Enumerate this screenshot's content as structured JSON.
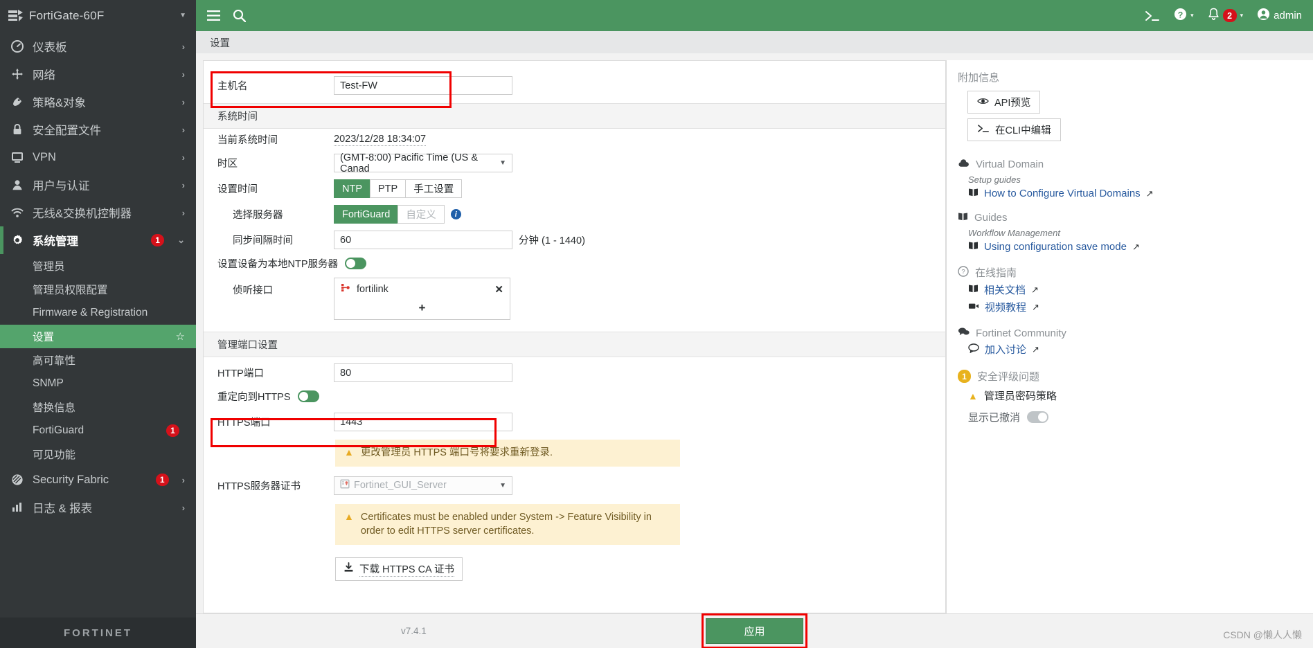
{
  "brand": {
    "name": "FortiGate-60F",
    "icon": "fortigate-device-icon",
    "caret": "▼"
  },
  "topbar": {
    "menu_icon": "hamburger-menu-icon",
    "search_icon": "search-icon",
    "cli_icon": "cli-console-icon",
    "help_icon": "help-circle-icon",
    "bell_icon": "notification-bell-icon",
    "bell_count": "2",
    "user_icon": "user-avatar-icon",
    "user_name": "admin",
    "caret": "▾"
  },
  "sidebar": {
    "items": [
      {
        "label": "仪表板",
        "icon": "dashboard-icon",
        "chev": "›",
        "badge": ""
      },
      {
        "label": "网络",
        "icon": "network-icon",
        "chev": "›",
        "badge": ""
      },
      {
        "label": "策略&对象",
        "icon": "policy-icon",
        "chev": "›",
        "badge": ""
      },
      {
        "label": "安全配置文件",
        "icon": "lock-icon",
        "chev": "›",
        "badge": ""
      },
      {
        "label": "VPN",
        "icon": "monitor-icon",
        "chev": "›",
        "badge": ""
      },
      {
        "label": "用户与认证",
        "icon": "user-icon",
        "chev": "›",
        "badge": ""
      },
      {
        "label": "无线&交换机控制器",
        "icon": "wifi-icon",
        "chev": "›",
        "badge": ""
      },
      {
        "label": "系统管理",
        "icon": "gear-icon",
        "chev": "⌄",
        "badge": "1",
        "active": true
      }
    ],
    "sub_items": [
      {
        "label": "管理员",
        "badge": ""
      },
      {
        "label": "管理员权限配置",
        "badge": ""
      },
      {
        "label": "Firmware & Registration",
        "badge": ""
      },
      {
        "label": "设置",
        "badge": "",
        "selected": true,
        "star": "☆"
      },
      {
        "label": "高可靠性",
        "badge": ""
      },
      {
        "label": "SNMP",
        "badge": ""
      },
      {
        "label": "替换信息",
        "badge": ""
      },
      {
        "label": "FortiGuard",
        "badge": "1"
      },
      {
        "label": "可见功能",
        "badge": ""
      }
    ],
    "items_after": [
      {
        "label": "Security Fabric",
        "icon": "fabric-icon",
        "chev": "›",
        "badge": "1"
      },
      {
        "label": "日志 & 报表",
        "icon": "chart-bar-icon",
        "chev": "›",
        "badge": ""
      }
    ],
    "footer_logo": "FORTINET"
  },
  "breadcrumb": {
    "label": "设置"
  },
  "form": {
    "hostname": {
      "label": "主机名",
      "value": "Test-FW"
    },
    "system_time": {
      "section": "系统时间",
      "current_label": "当前系统时间",
      "current_value": "2023/12/28 18:34:07",
      "timezone_label": "时区",
      "timezone_value": "(GMT-8:00) Pacific Time (US & Canad",
      "set_time_label": "设置时间",
      "set_time_options": [
        "NTP",
        "PTP",
        "手工设置"
      ],
      "set_time_selected": "NTP",
      "server_label": "选择服务器",
      "server_options": [
        "FortiGuard",
        "自定义"
      ],
      "server_selected": "FortiGuard",
      "interval_label": "同步间隔时间",
      "interval_value": "60",
      "interval_suffix": "分钟 (1 - 1440)",
      "local_ntp_label": "设置设备为本地NTP服务器",
      "local_ntp_on": true,
      "listen_label": "侦听接口",
      "listen_iface": "fortilink",
      "listen_iface_icon": "fortilink-interface-icon",
      "remove_icon": "close-x-icon",
      "add_icon": "plus-icon"
    },
    "mgmt": {
      "section": "管理端口设置",
      "http_label": "HTTP端口",
      "http_value": "80",
      "redirect_label": "重定向到HTTPS",
      "redirect_on": true,
      "https_label": "HTTPS端口",
      "https_value": "1443",
      "https_warning": "更改管理员 HTTPS 端口号将要求重新登录.",
      "cert_label": "HTTPS服务器证书",
      "cert_value": "Fortinet_GUI_Server",
      "cert_icon": "certificate-icon",
      "cert_warning": "Certificates must be enabled under System -> Feature Visibility in order to edit HTTPS server certificates.",
      "download_label": "下载 HTTPS CA 证书",
      "download_icon": "download-icon",
      "warn_icon": "warning-triangle-icon"
    }
  },
  "right_panel": {
    "title": "附加信息",
    "api_preview": {
      "label": "API预览",
      "icon": "eye-icon"
    },
    "edit_cli": {
      "label": "在CLI中编辑",
      "icon": "cli-prompt-icon"
    },
    "groups": [
      {
        "heading": "Virtual Domain",
        "icon": "cloud-icon",
        "subheading": "Setup guides",
        "links": [
          {
            "label": "How to Configure Virtual Domains",
            "icon": "book-icon",
            "ext": "external-link-icon"
          }
        ]
      },
      {
        "heading": "Guides",
        "icon": "book-icon",
        "subheading": "Workflow Management",
        "links": [
          {
            "label": "Using configuration save mode",
            "icon": "book-icon",
            "ext": "external-link-icon"
          }
        ]
      },
      {
        "heading": "在线指南",
        "icon": "question-circle-icon",
        "subheading": "",
        "links": [
          {
            "label": "相关文档",
            "icon": "book-icon",
            "ext": "external-link-icon"
          },
          {
            "label": "视频教程",
            "icon": "video-icon",
            "ext": "external-link-icon"
          }
        ]
      },
      {
        "heading": "Fortinet Community",
        "icon": "comments-icon",
        "subheading": "",
        "links": [
          {
            "label": "加入讨论",
            "icon": "comment-icon",
            "ext": "external-link-icon"
          }
        ]
      }
    ],
    "security_rating": {
      "badge": "1",
      "heading": "安全评级问题",
      "issue": "管理员密码策略",
      "issue_icon": "warning-triangle-icon",
      "dismiss_label": "显示已撤消",
      "dismiss_on": false
    }
  },
  "bottom": {
    "apply_label": "应用",
    "version": "v7.4.1",
    "watermark": "CSDN @懒人人懒"
  },
  "colors": {
    "green": "#4b9560",
    "dark": "#333739",
    "red": "#d6111a",
    "anno": "#f00000",
    "link": "#27599e"
  }
}
